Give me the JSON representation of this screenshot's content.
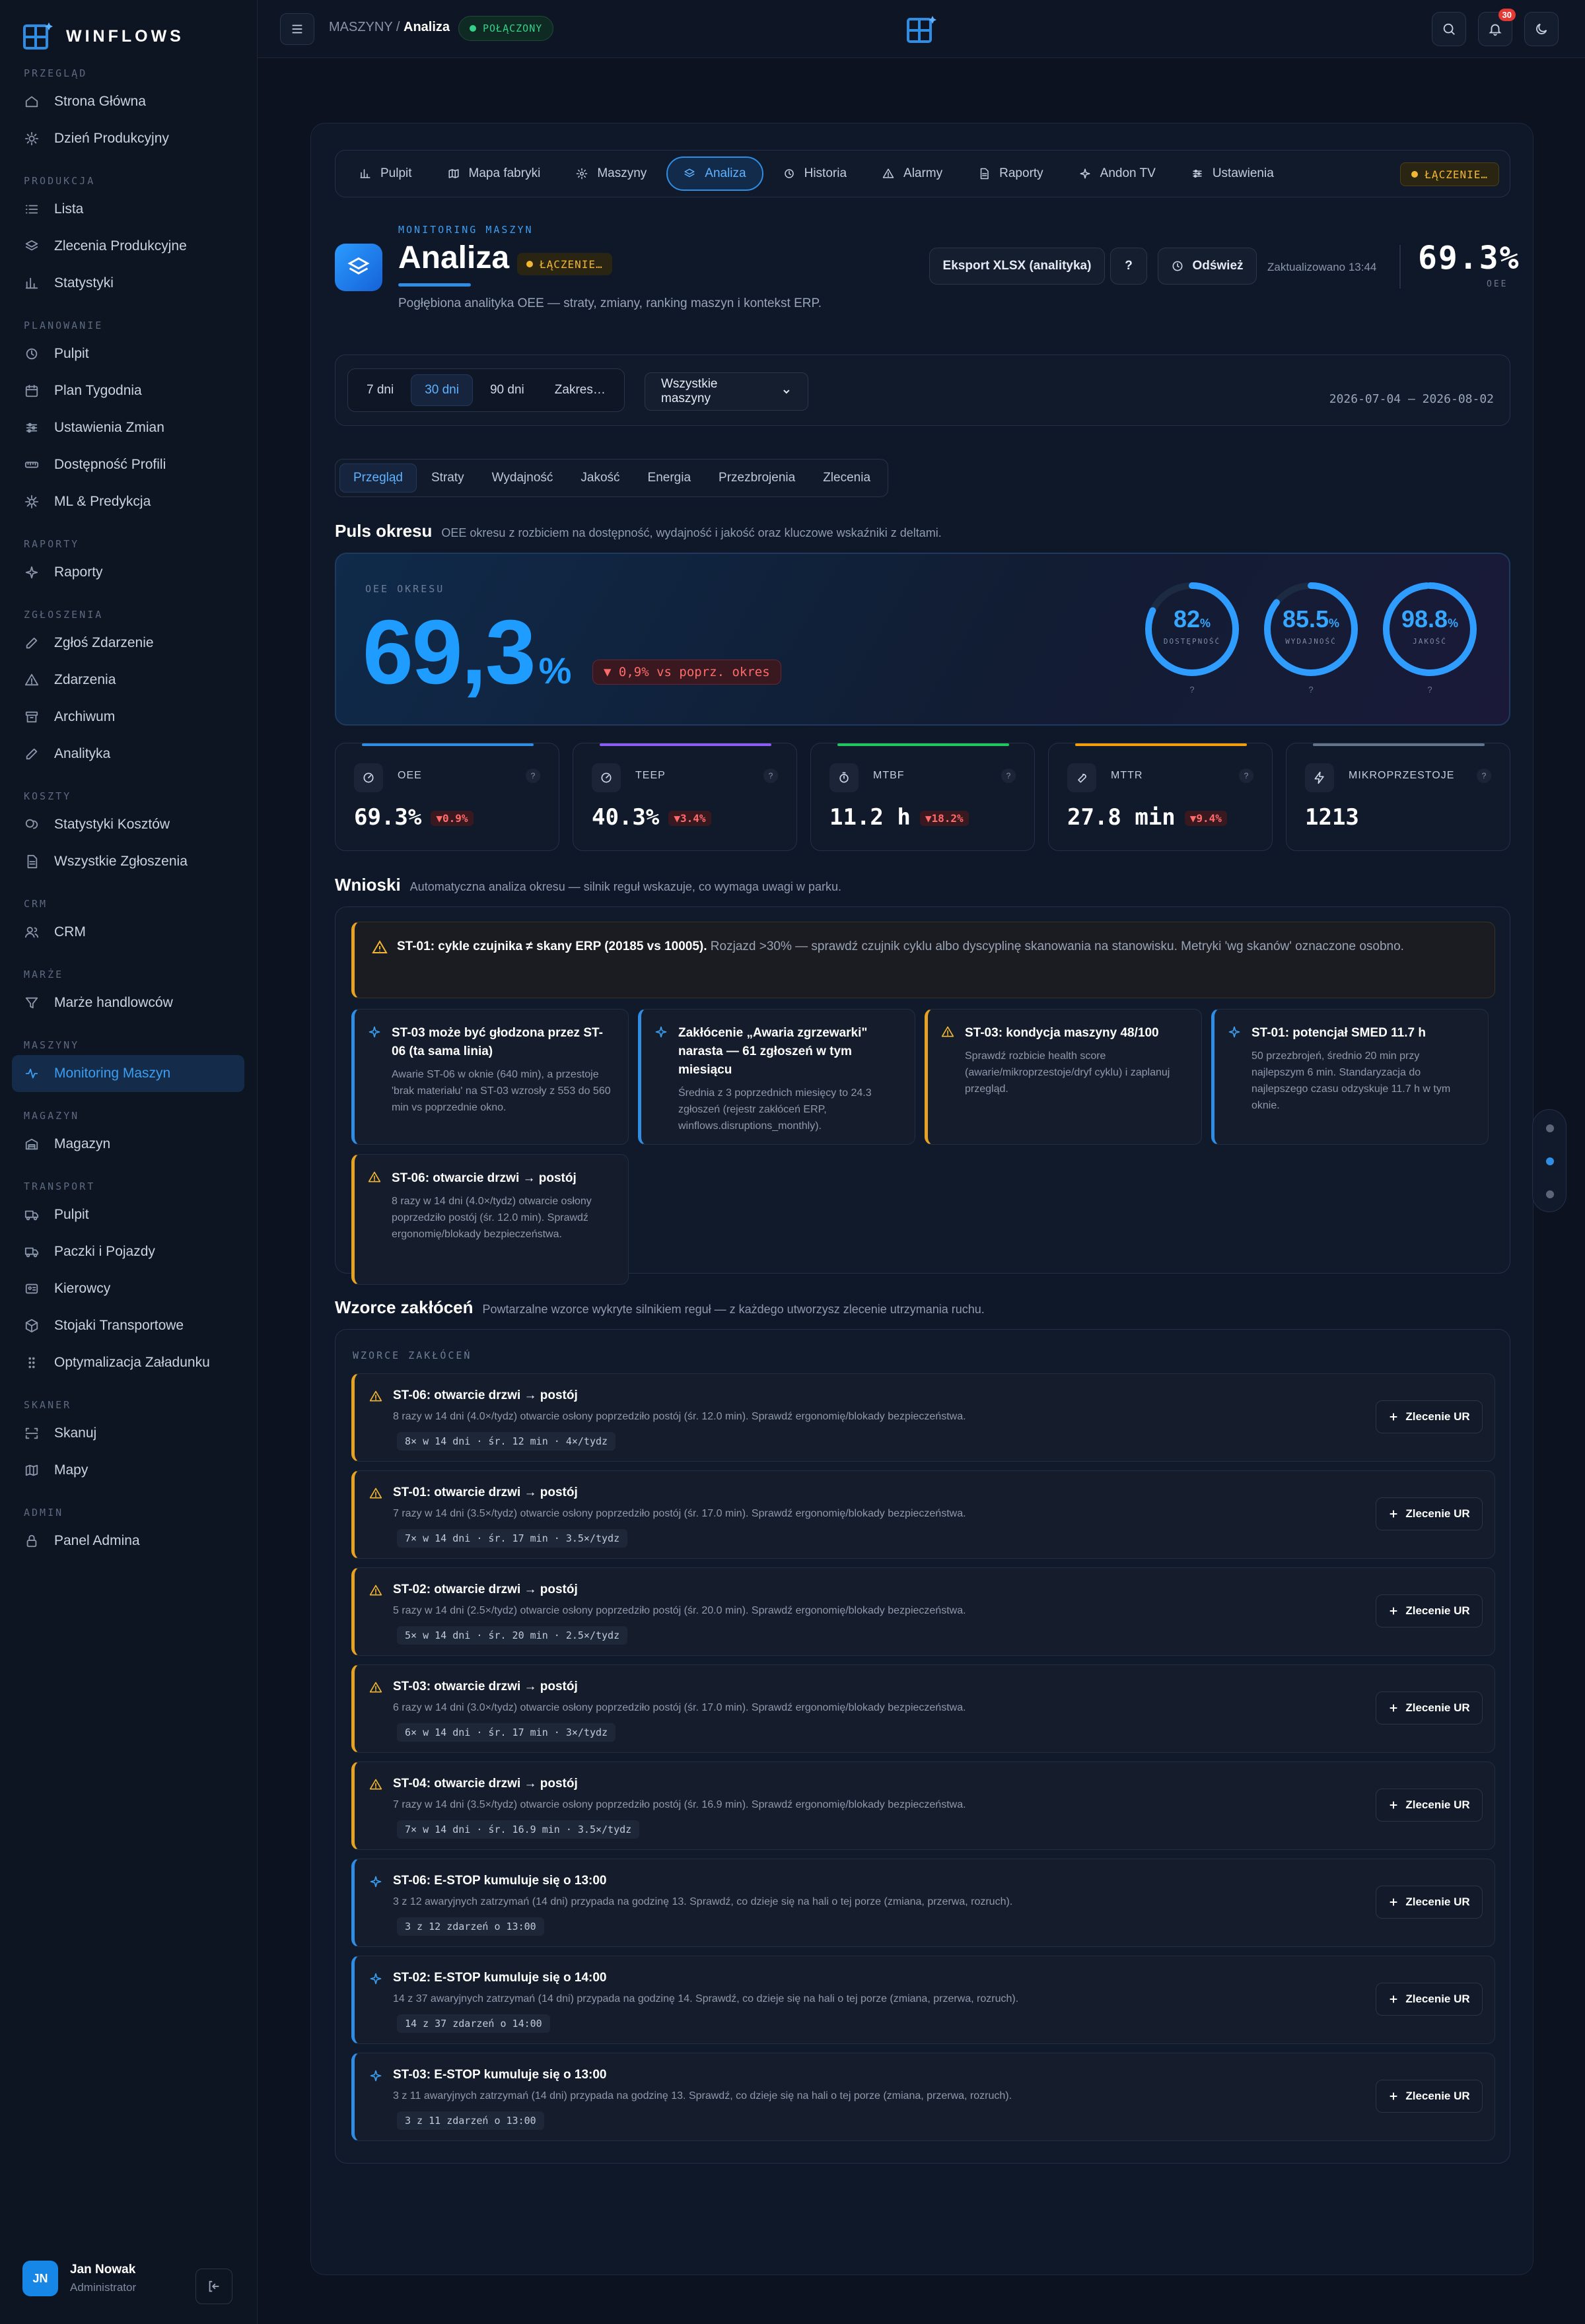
{
  "app": {
    "name": "WINFLOWS"
  },
  "sidebar": {
    "sections": [
      {
        "title": "PRZEGLĄD",
        "items": [
          {
            "label": "Strona Główna",
            "icon": "home-icon"
          },
          {
            "label": "Dzień Produkcyjny",
            "icon": "sun-icon"
          }
        ]
      },
      {
        "title": "PRODUKCJA",
        "items": [
          {
            "label": "Lista",
            "icon": "list-icon"
          },
          {
            "label": "Zlecenia Produkcyjne",
            "icon": "layers-icon"
          },
          {
            "label": "Statystyki",
            "icon": "bar-chart-icon"
          }
        ]
      },
      {
        "title": "PLANOWANIE",
        "items": [
          {
            "label": "Pulpit",
            "icon": "clock-icon"
          },
          {
            "label": "Plan Tygodnia",
            "icon": "calendar-icon"
          },
          {
            "label": "Ustawienia Zmian",
            "icon": "sliders-icon"
          },
          {
            "label": "Dostępność Profili",
            "icon": "ruler-icon"
          },
          {
            "label": "ML & Predykcja",
            "icon": "cpu-icon"
          }
        ]
      },
      {
        "title": "RAPORTY",
        "items": [
          {
            "label": "Raporty",
            "icon": "sparkle-icon"
          }
        ]
      },
      {
        "title": "ZGŁOSZENIA",
        "items": [
          {
            "label": "Zgłoś Zdarzenie",
            "icon": "edit-icon"
          },
          {
            "label": "Zdarzenia",
            "icon": "warning-icon"
          },
          {
            "label": "Archiwum",
            "icon": "archive-icon"
          },
          {
            "label": "Analityka",
            "icon": "edit-icon"
          }
        ]
      },
      {
        "title": "KOSZTY",
        "items": [
          {
            "label": "Statystyki Kosztów",
            "icon": "coins-icon"
          },
          {
            "label": "Wszystkie Zgłoszenia",
            "icon": "file-icon"
          }
        ]
      },
      {
        "title": "CRM",
        "items": [
          {
            "label": "CRM",
            "icon": "users-icon"
          }
        ]
      },
      {
        "title": "MARŻE",
        "items": [
          {
            "label": "Marże handlowców",
            "icon": "filter-icon"
          }
        ]
      },
      {
        "title": "MASZYNY",
        "items": [
          {
            "label": "Monitoring Maszyn",
            "icon": "activity-icon",
            "active": true
          }
        ]
      },
      {
        "title": "MAGAZYN",
        "items": [
          {
            "label": "Magazyn",
            "icon": "warehouse-icon"
          }
        ]
      },
      {
        "title": "TRANSPORT",
        "items": [
          {
            "label": "Pulpit",
            "icon": "truck-icon"
          },
          {
            "label": "Paczki i Pojazdy",
            "icon": "truck-icon"
          },
          {
            "label": "Kierowcy",
            "icon": "id-card-icon"
          },
          {
            "label": "Stojaki Transportowe",
            "icon": "box-icon"
          },
          {
            "label": "Optymalizacja Załadunku",
            "icon": "grip-icon"
          }
        ]
      },
      {
        "title": "SKANER",
        "items": [
          {
            "label": "Skanuj",
            "icon": "scan-icon"
          },
          {
            "label": "Mapy",
            "icon": "map-icon"
          }
        ]
      },
      {
        "title": "ADMIN",
        "items": [
          {
            "label": "Panel Admina",
            "icon": "lock-icon"
          }
        ]
      }
    ],
    "user": {
      "initials": "JN",
      "name": "Jan Nowak",
      "role": "Administrator"
    }
  },
  "topbar": {
    "breadcrumb_parent": "MASZYNY",
    "breadcrumb_sep": "/",
    "breadcrumb_current": "Analiza",
    "connection": "POŁĄCZONY",
    "notifications": "30"
  },
  "tabs": [
    {
      "label": "Pulpit",
      "icon": "bar-chart-icon"
    },
    {
      "label": "Mapa fabryki",
      "icon": "map-icon"
    },
    {
      "label": "Maszyny",
      "icon": "gear-icon"
    },
    {
      "label": "Analiza",
      "icon": "layers-icon",
      "active": true
    },
    {
      "label": "Historia",
      "icon": "clock-icon"
    },
    {
      "label": "Alarmy",
      "icon": "warning-icon"
    },
    {
      "label": "Raporty",
      "icon": "file-icon"
    },
    {
      "label": "Andon TV",
      "icon": "sparkle-icon"
    },
    {
      "label": "Ustawienia",
      "icon": "sliders-icon"
    }
  ],
  "tabs_status": "ŁĄCZENIE…",
  "header": {
    "kicker": "MONITORING MASZYN",
    "title": "Analiza",
    "status": "ŁĄCZENIE…",
    "subtitle": "Pogłębiona analityka OEE — straty, zmiany, ranking maszyn i kontekst ERP.",
    "export_label": "Eksport XLSX (analityka)",
    "help_label": "?",
    "refresh_label": "Odśwież",
    "updated": "Zaktualizowano 13:44",
    "oee_value": "69.3%",
    "oee_caption": "OEE"
  },
  "filters": {
    "ranges": [
      {
        "label": "7 dni"
      },
      {
        "label": "30 dni",
        "active": true
      },
      {
        "label": "90 dni"
      },
      {
        "label": "Zakres…"
      }
    ],
    "machine_select": "Wszystkie maszyny",
    "date_range": "2026-07-04 – 2026-08-02"
  },
  "subtabs": [
    {
      "label": "Przegląd",
      "active": true
    },
    {
      "label": "Straty"
    },
    {
      "label": "Wydajność"
    },
    {
      "label": "Jakość"
    },
    {
      "label": "Energia"
    },
    {
      "label": "Przezbrojenia"
    },
    {
      "label": "Zlecenia"
    }
  ],
  "pulse": {
    "title": "Puls okresu",
    "desc": "OEE okresu z rozbiciem na dostępność, wydajność i jakość oraz kluczowe wskaźniki z deltami.",
    "caption": "OEE OKRESU",
    "value": "69,3",
    "unit": "%",
    "delta": "▼ 0,9% vs poprz. okres",
    "rings": [
      {
        "value": "82",
        "unit": "%",
        "label": "DOSTĘPNOŚĆ",
        "percent": 82,
        "help": "?"
      },
      {
        "value": "85.5",
        "unit": "%",
        "label": "WYDAJNOŚĆ",
        "percent": 85.5,
        "help": "?"
      },
      {
        "value": "98.8",
        "unit": "%",
        "label": "JAKOŚĆ",
        "percent": 98.8,
        "help": "?"
      }
    ]
  },
  "kpis": [
    {
      "label": "OEE",
      "value": "69.3%",
      "delta": "▼0.9%",
      "icon": "gauge-icon",
      "color": "#2f8de4",
      "help": "?"
    },
    {
      "label": "TEEP",
      "value": "40.3%",
      "delta": "▼3.4%",
      "icon": "gauge-icon",
      "color": "#8b5cf6",
      "help": "?"
    },
    {
      "label": "MTBF",
      "value": "11.2 h",
      "delta": "▼18.2%",
      "icon": "timer-icon",
      "color": "#22c55e",
      "help": "?"
    },
    {
      "label": "MTTR",
      "value": "27.8 min",
      "delta": "▼9.4%",
      "icon": "wrench-icon",
      "color": "#f59e0b",
      "help": "?"
    },
    {
      "label": "MIKROPRZESTOJE",
      "value": "1213",
      "delta": "",
      "icon": "bolt-icon",
      "color": "#64748b",
      "help": "?"
    }
  ],
  "insights": {
    "title": "Wnioski",
    "desc": "Automatyczna analiza okresu — silnik reguł wskazuje, co wymaga uwagi w parku.",
    "banner_title": "ST-01: cykle czujnika ≠ skany ERP (20185 vs 10005).",
    "banner_text": " Rozjazd >30% — sprawdź czujnik cyklu albo dyscyplinę skanowania na stanowisku. Metryki 'wg skanów' oznaczone osobno.",
    "cards": [
      {
        "title": "ST-03 może być głodzona przez ST-06 (ta sama linia)",
        "text": "Awarie ST-06 w oknie (640 min), a przestoje 'brak materiału' na ST-03 wzrosły z 553 do 560 min vs poprzednie okno.",
        "kind": "blue"
      },
      {
        "title": "Zakłócenie „Awaria zgrzewarki\" narasta — 61 zgłoszeń w tym miesiącu",
        "text": "Średnia z 3 poprzednich miesięcy to 24.3 zgłoszeń (rejestr zakłóceń ERP, winflows.disruptions_monthly).",
        "kind": "blue"
      },
      {
        "title": "ST-03: kondycja maszyny 48/100",
        "text": "Sprawdź rozbicie health score (awarie/mikroprzestoje/dryf cyklu) i zaplanuj przegląd.",
        "kind": "amber"
      },
      {
        "title": "ST-01: potencjał SMED 11.7 h",
        "text": "50 przezbrojeń, średnio 20 min przy najlepszym 6 min. Standaryzacja do najlepszego czasu odzyskuje 11.7 h w tym oknie.",
        "kind": "blue"
      },
      {
        "title": "ST-06: otwarcie drzwi → postój",
        "text": "8 razy w 14 dni (4.0×/tydz) otwarcie osłony poprzedziło postój (śr. 12.0 min). Sprawdź ergonomię/blokady bezpieczeństwa.",
        "kind": "amber"
      }
    ]
  },
  "patterns": {
    "title": "Wzorce zakłóceń",
    "desc": "Powtarzalne wzorce wykryte silnikiem reguł — z każdego utworzysz zlecenie utrzymania ruchu.",
    "caption": "WZORCE ZAKŁÓCEŃ",
    "button_label": "Zlecenie UR",
    "items": [
      {
        "title": "ST-06: otwarcie drzwi → postój",
        "text": "8 razy w 14 dni (4.0×/tydz) otwarcie osłony poprzedziło postój (śr. 12.0 min). Sprawdź ergonomię/blokady bezpieczeństwa.",
        "chip": "8× w 14 dni · śr. 12 min · 4×/tydz",
        "kind": "amber"
      },
      {
        "title": "ST-01: otwarcie drzwi → postój",
        "text": "7 razy w 14 dni (3.5×/tydz) otwarcie osłony poprzedziło postój (śr. 17.0 min). Sprawdź ergonomię/blokady bezpieczeństwa.",
        "chip": "7× w 14 dni · śr. 17 min · 3.5×/tydz",
        "kind": "amber"
      },
      {
        "title": "ST-02: otwarcie drzwi → postój",
        "text": "5 razy w 14 dni (2.5×/tydz) otwarcie osłony poprzedziło postój (śr. 20.0 min). Sprawdź ergonomię/blokady bezpieczeństwa.",
        "chip": "5× w 14 dni · śr. 20 min · 2.5×/tydz",
        "kind": "amber"
      },
      {
        "title": "ST-03: otwarcie drzwi → postój",
        "text": "6 razy w 14 dni (3.0×/tydz) otwarcie osłony poprzedziło postój (śr. 17.0 min). Sprawdź ergonomię/blokady bezpieczeństwa.",
        "chip": "6× w 14 dni · śr. 17 min · 3×/tydz",
        "kind": "amber"
      },
      {
        "title": "ST-04: otwarcie drzwi → postój",
        "text": "7 razy w 14 dni (3.5×/tydz) otwarcie osłony poprzedziło postój (śr. 16.9 min). Sprawdź ergonomię/blokady bezpieczeństwa.",
        "chip": "7× w 14 dni · śr. 16.9 min · 3.5×/tydz",
        "kind": "amber"
      },
      {
        "title": "ST-06: E-STOP kumuluje się o 13:00",
        "text": "3 z 12 awaryjnych zatrzymań (14 dni) przypada na godzinę 13. Sprawdź, co dzieje się na hali o tej porze (zmiana, przerwa, rozruch).",
        "chip": "3 z 12 zdarzeń o 13:00",
        "kind": "blue"
      },
      {
        "title": "ST-02: E-STOP kumuluje się o 14:00",
        "text": "14 z 37 awaryjnych zatrzymań (14 dni) przypada na godzinę 14. Sprawdź, co dzieje się na hali o tej porze (zmiana, przerwa, rozruch).",
        "chip": "14 z 37 zdarzeń o 14:00",
        "kind": "blue"
      },
      {
        "title": "ST-03: E-STOP kumuluje się o 13:00",
        "text": "3 z 11 awaryjnych zatrzymań (14 dni) przypada na godzinę 13. Sprawdź, co dzieje się na hali o tej porze (zmiana, przerwa, rozruch).",
        "chip": "3 z 11 zdarzeń o 13:00",
        "kind": "blue"
      }
    ]
  },
  "colors": {
    "accent": "#2f8de4",
    "warning": "#e6a223",
    "danger": "#ff6b6b",
    "success": "#35d08a"
  }
}
